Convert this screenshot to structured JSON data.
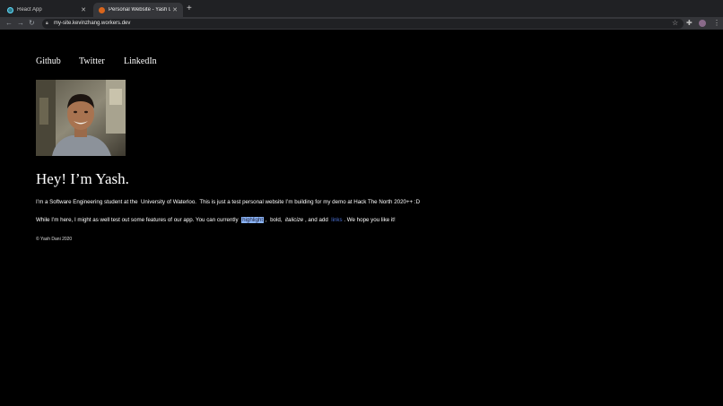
{
  "browser": {
    "tabs": [
      {
        "title": "React App",
        "active": false
      },
      {
        "title": "Personal Website - Yash Dani",
        "active": true
      }
    ],
    "url": "my-site.kevinzhang.workers.dev"
  },
  "nav": {
    "github": "Github",
    "twitter": "Twitter",
    "linkedin": "LinkedIn"
  },
  "heading": "Hey! I’m Yash.",
  "intro": {
    "before": "I’m a Software Engineering student at the",
    "school": "University of Waterloo.",
    "after": "This is just a test personal website I’m building for my demo at Hack The North 2020++ :D"
  },
  "features": {
    "before": "While I’m here, I might as well test out some features of our app. You can currently",
    "highlight": "highlight",
    "sep1": ",",
    "bold": "bold,",
    "italic": "italicize",
    "mid": ", and add",
    "links": "links",
    "end": ". We hope you like it!"
  },
  "footer": "© Yash Dani 2020",
  "colors": {
    "background": "#000000",
    "highlight": "#8ab4f8",
    "link": "#4a6fd0"
  }
}
